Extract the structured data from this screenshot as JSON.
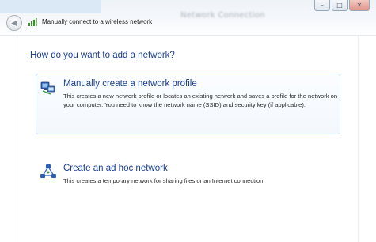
{
  "window": {
    "title": "Manually connect to a wireless network",
    "blurred_caption": "Network Connection",
    "controls": {
      "minimize": "–",
      "maximize": "□",
      "close": "✕"
    },
    "back_icon": "back-arrow-icon",
    "wizard_icon": "wireless-network-icon"
  },
  "main": {
    "question": "How do you want to add a network?",
    "options": [
      {
        "title": "Manually create a network profile",
        "description": "This creates a new network profile or locates an existing network and saves a profile for the network on your computer. You need to know the network name (SSID) and security key (if applicable).",
        "icon": "network-profile-icon",
        "selected": true
      },
      {
        "title": "Create an ad hoc network",
        "description": "This creates a temporary network for sharing files or an Internet connection",
        "icon": "ad-hoc-network-icon",
        "selected": false
      }
    ]
  },
  "colors": {
    "link_blue": "#1a3d8f",
    "selection_border": "#c5dcf2",
    "selection_fill": "#f3f8fd"
  }
}
